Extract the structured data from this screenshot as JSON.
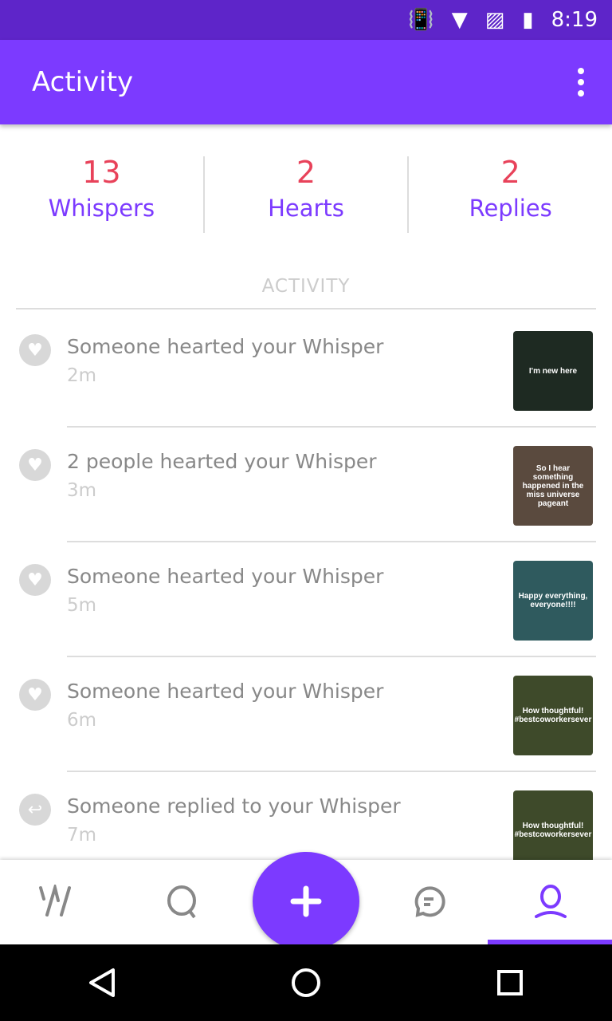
{
  "status": {
    "time": "8:19"
  },
  "appbar": {
    "title": "Activity"
  },
  "stats": [
    {
      "value": "13",
      "label": "Whispers"
    },
    {
      "value": "2",
      "label": "Hearts"
    },
    {
      "value": "2",
      "label": "Replies"
    }
  ],
  "section_label": "ACTIVITY",
  "items": [
    {
      "icon": "heart-icon",
      "text": "Someone hearted your Whisper",
      "time": "2m",
      "thumb": "I'm new here",
      "bg": "#1e2a22"
    },
    {
      "icon": "heart-icon",
      "text": "2 people hearted your Whisper",
      "time": "3m",
      "thumb": "So I hear something happened in the miss universe pageant",
      "bg": "#5a4a3e"
    },
    {
      "icon": "heart-icon",
      "text": "Someone hearted your Whisper",
      "time": "5m",
      "thumb": "Happy everything, everyone!!!!",
      "bg": "#2f5a5e"
    },
    {
      "icon": "heart-icon",
      "text": "Someone hearted your Whisper",
      "time": "6m",
      "thumb": "How thoughtful! #bestcoworkersever",
      "bg": "#3e4a2a"
    },
    {
      "icon": "reply-icon",
      "text": "Someone replied to your Whisper",
      "time": "7m",
      "thumb": "How thoughtful! #bestcoworkersever",
      "bg": "#3e4a2a"
    }
  ],
  "colors": {
    "accent": "#7c3aff",
    "count": "#e8425a"
  }
}
